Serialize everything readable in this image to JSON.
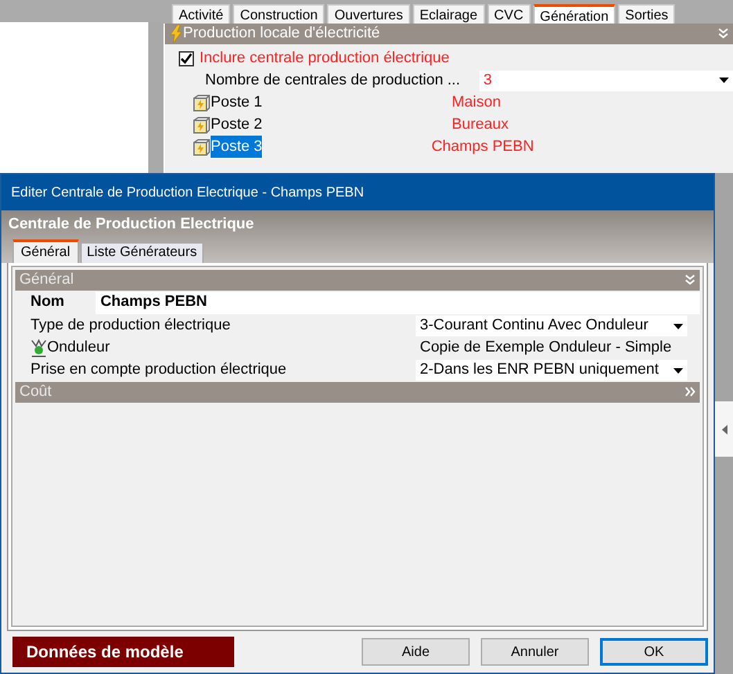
{
  "main_tabs": [
    {
      "label": "Activité",
      "selected": false
    },
    {
      "label": "Construction",
      "selected": false
    },
    {
      "label": "Ouvertures",
      "selected": false
    },
    {
      "label": "Eclairage",
      "selected": false
    },
    {
      "label": "CVC",
      "selected": false
    },
    {
      "label": "Génération",
      "selected": true
    },
    {
      "label": "Sorties",
      "selected": false
    }
  ],
  "section": {
    "title": "Production locale d'électricité",
    "expanded": true
  },
  "include": {
    "label": "Inclure centrale production électrique",
    "checked": true
  },
  "count": {
    "label": "Nombre de centrales de production ...",
    "value": "3"
  },
  "postes": [
    {
      "label": "Poste 1",
      "value": "Maison",
      "selected": false
    },
    {
      "label": "Poste 2",
      "value": "Bureaux",
      "selected": false
    },
    {
      "label": "Poste 3",
      "value": "Champs PEBN",
      "selected": true
    }
  ],
  "dialog": {
    "title": "Editer Centrale de Production Electrique - Champs PEBN",
    "header": "Centrale de Production Electrique",
    "tabs": [
      {
        "label": "Général",
        "selected": true
      },
      {
        "label": "Liste Générateurs",
        "selected": false
      }
    ],
    "groups": [
      {
        "title": "Général",
        "expanded": true,
        "rows": [
          {
            "kind": "name",
            "label": "Nom",
            "value": "Champs PEBN"
          },
          {
            "kind": "dropdown",
            "label": "Type de production électrique",
            "value": "3-Courant Continu Avec Onduleur"
          },
          {
            "kind": "link",
            "label": "Onduleur",
            "value": "Copie de Exemple Onduleur - Simple"
          },
          {
            "kind": "dropdown",
            "label": "Prise en compte production électrique",
            "value": "2-Dans les ENR PEBN uniquement"
          }
        ]
      },
      {
        "title": "Coût",
        "expanded": false
      }
    ],
    "model_label": "Données de modèle",
    "buttons": [
      {
        "label": "Aide",
        "default": false
      },
      {
        "label": "Annuler",
        "default": false
      },
      {
        "label": "OK",
        "default": true
      }
    ]
  }
}
